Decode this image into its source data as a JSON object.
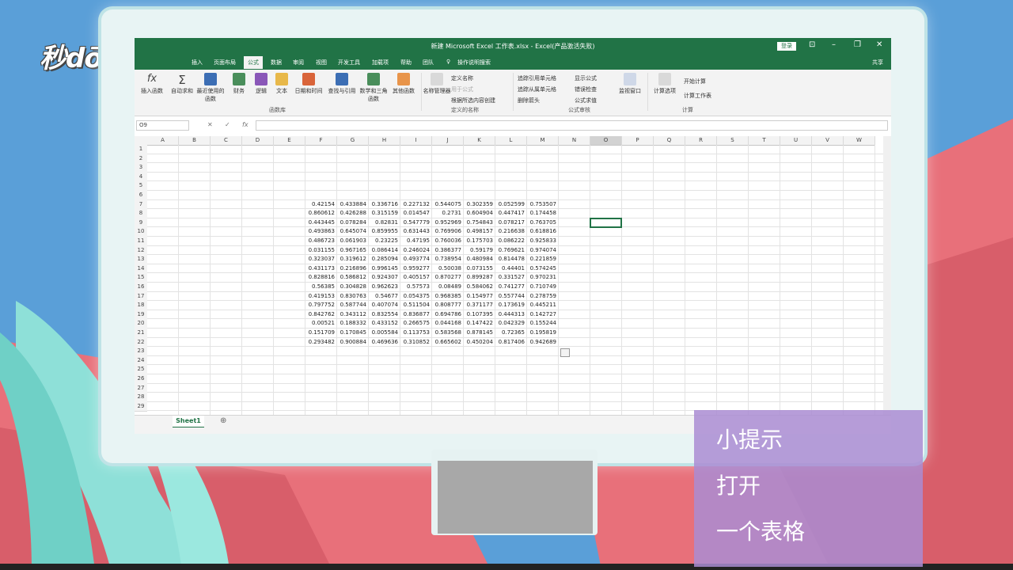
{
  "logo": "秒dōng视频",
  "excel": {
    "title": "新建 Microsoft Excel 工作表.xlsx - Excel(产品激活失败)",
    "login": "登录",
    "share": "共享",
    "tabs": [
      "插入",
      "页面布局",
      "公式",
      "数据",
      "审阅",
      "视图",
      "开发工具",
      "加载项",
      "帮助",
      "团队",
      "操作说明搜索"
    ],
    "active_tab": "公式",
    "ribbon": {
      "insert_function": "插入函数",
      "autosum": "自动求和",
      "recent": "最近使用的函数",
      "finance": "财务",
      "logic": "逻辑",
      "text": "文本",
      "datetime": "日期和时间",
      "lookup": "查找与引用",
      "math": "数学和三角函数",
      "other": "其他函数",
      "group_library": "函数库",
      "name_manager": "名称管理器",
      "define_name": "定义名称",
      "use_in_formula": "用于公式",
      "create_from_selection": "根据所选内容创建",
      "group_names": "定义的名称",
      "trace_precedents": "追踪引用单元格",
      "trace_dependents": "追踪从属单元格",
      "remove_arrows": "删除箭头",
      "show_formulas": "显示公式",
      "error_checking": "错误检查",
      "evaluate_formula": "公式求值",
      "watch_window": "监视窗口",
      "group_auditing": "公式审核",
      "calc_options": "计算选项",
      "calc_now": "开始计算",
      "calc_sheet": "计算工作表",
      "group_calc": "计算"
    },
    "name_box": "O9",
    "fx": "fx",
    "columns": [
      "A",
      "B",
      "C",
      "D",
      "E",
      "F",
      "G",
      "H",
      "I",
      "J",
      "K",
      "L",
      "M",
      "N",
      "O",
      "P",
      "Q",
      "R",
      "S",
      "T",
      "U",
      "V",
      "W"
    ],
    "rows": [
      "1",
      "2",
      "3",
      "4",
      "5",
      "6",
      "7",
      "8",
      "9",
      "10",
      "11",
      "12",
      "13",
      "14",
      "15",
      "16",
      "17",
      "18",
      "19",
      "20",
      "21",
      "22",
      "23",
      "24",
      "25",
      "26",
      "27",
      "28",
      "29"
    ],
    "data_start_row": 7,
    "data": [
      [
        "0.42154",
        "0.433884",
        "0.336716",
        "0.227132",
        "0.544075",
        "0.302359",
        "0.052599",
        "0.753507"
      ],
      [
        "0.860612",
        "0.426288",
        "0.315159",
        "0.014547",
        "0.2731",
        "0.604904",
        "0.447417",
        "0.174458"
      ],
      [
        "0.443445",
        "0.078284",
        "0.82831",
        "0.547779",
        "0.952969",
        "0.754843",
        "0.078217",
        "0.763705"
      ],
      [
        "0.493863",
        "0.645074",
        "0.859955",
        "0.631443",
        "0.769906",
        "0.498157",
        "0.216638",
        "0.618816"
      ],
      [
        "0.486723",
        "0.061903",
        "0.23225",
        "0.47195",
        "0.760036",
        "0.175703",
        "0.086222",
        "0.925833"
      ],
      [
        "0.031155",
        "0.967165",
        "0.086414",
        "0.246024",
        "0.386377",
        "0.59179",
        "0.769621",
        "0.974074"
      ],
      [
        "0.323037",
        "0.319612",
        "0.285094",
        "0.493774",
        "0.738954",
        "0.480984",
        "0.814478",
        "0.221859"
      ],
      [
        "0.431173",
        "0.216896",
        "0.996145",
        "0.959277",
        "0.50038",
        "0.073155",
        "0.44401",
        "0.574245"
      ],
      [
        "0.828816",
        "0.586812",
        "0.924307",
        "0.405157",
        "0.870277",
        "0.899287",
        "0.331527",
        "0.970231"
      ],
      [
        "0.56385",
        "0.304828",
        "0.962623",
        "0.57573",
        "0.08489",
        "0.584062",
        "0.741277",
        "0.710749"
      ],
      [
        "0.419153",
        "0.830763",
        "0.54677",
        "0.054375",
        "0.968385",
        "0.154977",
        "0.557744",
        "0.278759"
      ],
      [
        "0.797752",
        "0.587744",
        "0.407074",
        "0.511504",
        "0.808777",
        "0.371177",
        "0.173619",
        "0.445211"
      ],
      [
        "0.842762",
        "0.343112",
        "0.832554",
        "0.836877",
        "0.694786",
        "0.107395",
        "0.444313",
        "0.142727"
      ],
      [
        "0.00521",
        "0.188332",
        "0.433152",
        "0.266575",
        "0.044168",
        "0.147422",
        "0.042329",
        "0.155244"
      ],
      [
        "0.151709",
        "0.170845",
        "0.005584",
        "0.113753",
        "0.583568",
        "0.878145",
        "0.72365",
        "0.195819"
      ],
      [
        "0.293482",
        "0.900884",
        "0.469636",
        "0.310852",
        "0.665602",
        "0.450204",
        "0.817406",
        "0.942689"
      ]
    ],
    "sheet_tab": "Sheet1"
  },
  "tips": [
    "小提示",
    "打开",
    "一个表格"
  ]
}
